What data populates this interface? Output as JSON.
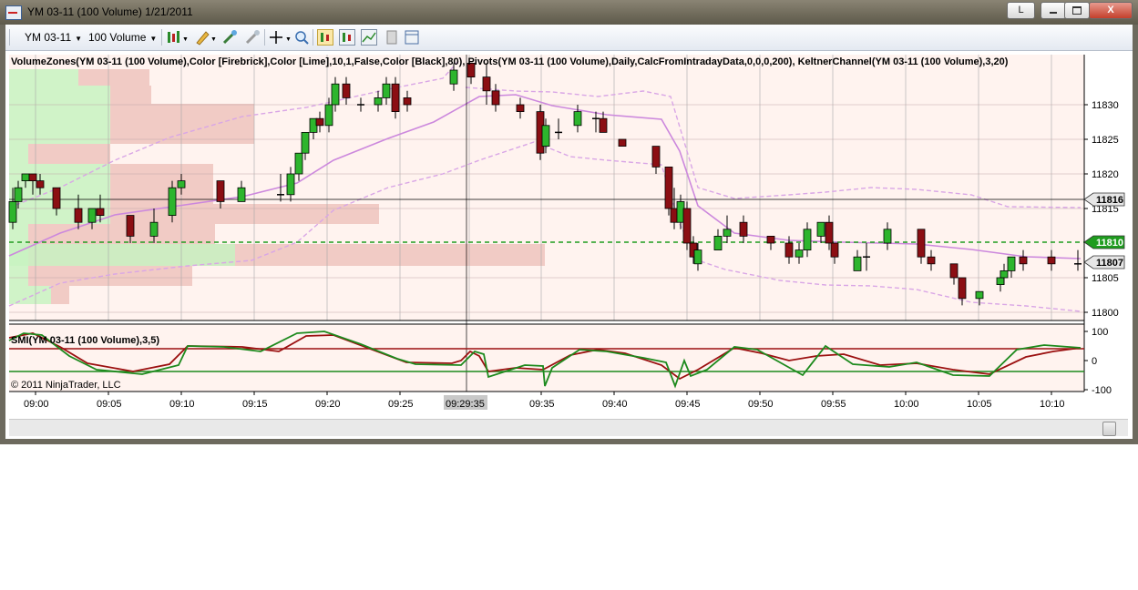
{
  "window": {
    "title": "YM 03-11 (100 Volume)  1/21/2011",
    "buttons": {
      "restore_label": "L",
      "close_label": "X"
    }
  },
  "toolbar": {
    "instrument": "YM 03-11",
    "interval": "100 Volume",
    "icons": [
      "candlestick-icon",
      "pencil-icon",
      "hand-icon",
      "drag-icon",
      "crosshair-icon",
      "zoom-icon",
      "data-box-icon",
      "chart-properties-icon",
      "strategies-icon",
      "template-icon",
      "panel-icon"
    ]
  },
  "chart": {
    "indicator_header": "VolumeZones(YM 03-11 (100 Volume),Color [Firebrick],Color [Lime],10,1,False,Color [Black],80), Pivots(YM 03-11 (100 Volume),Daily,CalcFromIntradayData,0,0,0,200), KeltnerChannel(YM 03-11 (100 Volume),3,20)",
    "smi_header": "SMI(YM 03-11 (100 Volume),3,5)",
    "copyright": "© 2011 NinjaTrader, LLC",
    "price_ticks": [
      "11830",
      "11825",
      "11820",
      "11815",
      "11805",
      "11800"
    ],
    "price_markers": {
      "upper": "11816",
      "pivot": "11810",
      "last": "11807"
    },
    "smi_ticks": [
      "100",
      "0",
      "-100"
    ],
    "time_ticks": [
      "09:00",
      "09:05",
      "09:10",
      "09:15",
      "09:20",
      "09:25",
      "09:35",
      "09:40",
      "09:45",
      "09:50",
      "09:55",
      "10:00",
      "10:05",
      "10:10"
    ],
    "crosshair_time": "09:29:35",
    "colors": {
      "up": "#2db52d",
      "down": "#8b0e13",
      "buy_zone": "#c8f2c1",
      "sell_zone": "#eec3bd",
      "keltner": "#cc88dd",
      "smi_green": "#1d8a1d",
      "smi_red": "#9b1010"
    }
  }
}
